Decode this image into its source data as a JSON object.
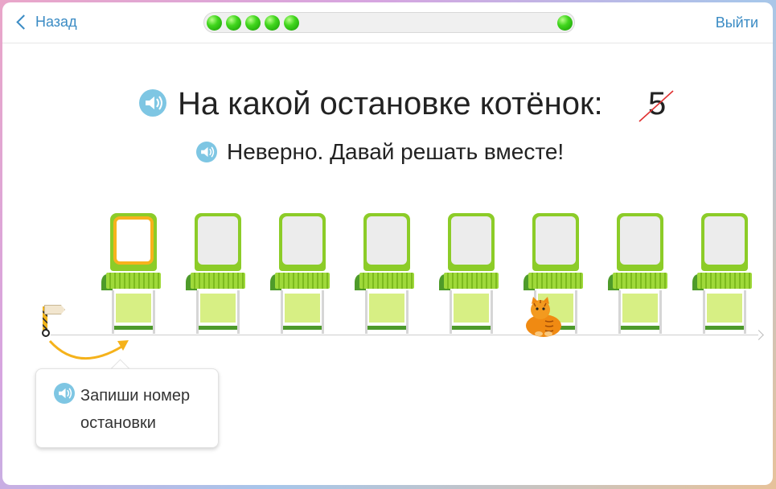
{
  "nav": {
    "back_label": "Назад",
    "exit_label": "Выйти"
  },
  "progress": {
    "filled_balls": 5,
    "end_marker": 1
  },
  "question": {
    "text": "На какой остановке котёнок:",
    "answer": "5",
    "answer_status": "wrong"
  },
  "feedback": {
    "text": "Неверно. Давай решать вместе!"
  },
  "stops": {
    "count": 8,
    "active_index": 0,
    "kitten_index": 5
  },
  "hint": {
    "text": "Запиши номер остановки"
  },
  "colors": {
    "accent": "#3a8bc4",
    "progress_ball": "#2fc014",
    "stop_green": "#8ccc28",
    "active_frame": "#f7b21d",
    "speaker": "#7ec6e3",
    "wrong_strike": "#e03030",
    "kitten": "#f08a12"
  },
  "icons": [
    "chevron-left-icon",
    "speaker-icon",
    "kitten-icon",
    "start-sign-icon",
    "curved-arrow-icon"
  ]
}
